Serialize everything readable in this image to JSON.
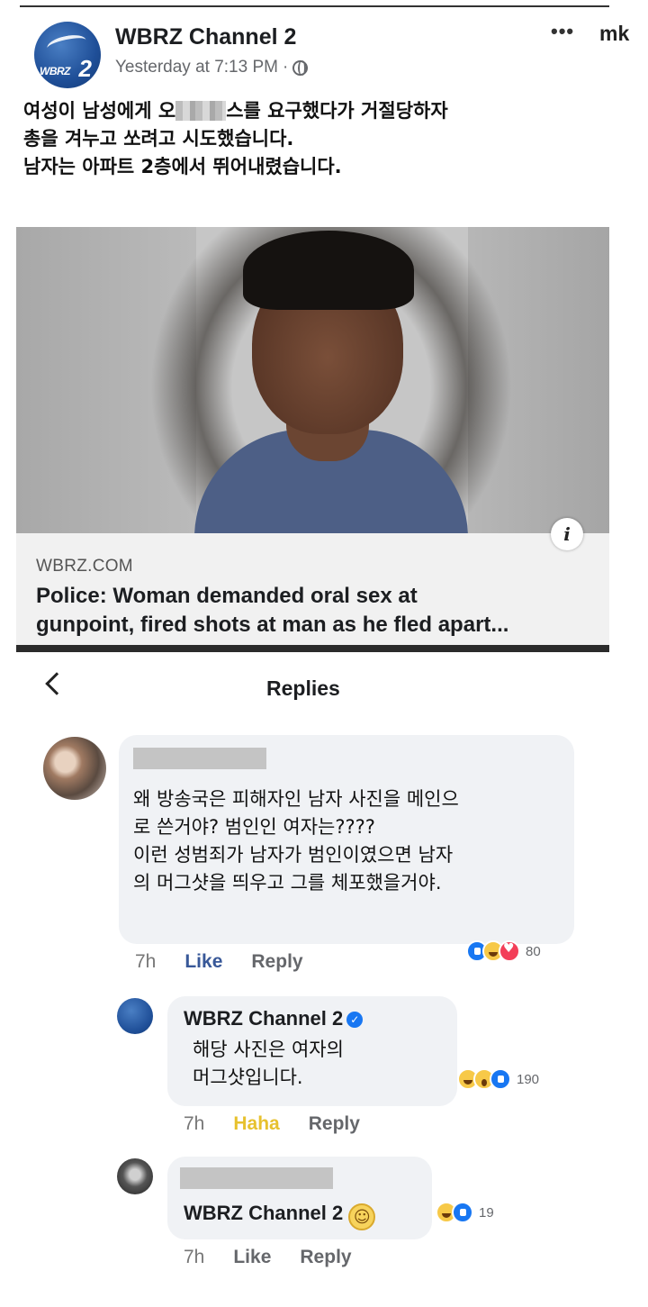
{
  "post": {
    "page_name": "WBRZ Channel 2",
    "timestamp": "Yesterday at 7:13 PM",
    "separator": "·",
    "more": "•••",
    "watermark": "mk",
    "avatar_logo_text": "WBRZ",
    "avatar_logo_num": "2",
    "text_line1_a": "여성이 남성에게 오",
    "text_line1_b": "스를 요구했다가 거절당하자",
    "text_line2": "총을 겨누고 쏘려고 시도했습니다.",
    "text_line3": "남자는 아파트 2층에서 뛰어내렸습니다."
  },
  "link": {
    "domain": "WBRZ.COM",
    "title_line1": "Police: Woman demanded oral sex at",
    "title_line2": "gunpoint, fired shots at man as he fled apart...",
    "info": "i"
  },
  "replies_header": {
    "title": "Replies"
  },
  "comments": [
    {
      "text_lines": [
        "왜 방송국은 피해자인 남자 사진을 메인으",
        "로 쓴거야? 범인인 여자는????",
        "이런 성범죄가 남자가 범인이였으면 남자",
        "의 머그샷을 띄우고 그를 체포했을거야."
      ],
      "time": "7h",
      "like": "Like",
      "reply": "Reply",
      "reaction_count": "80"
    },
    {
      "name": "WBRZ Channel 2",
      "verified": "✓",
      "text_lines": [
        "해당 사진은 여자의",
        "머그샷입니다."
      ],
      "time": "7h",
      "like": "Haha",
      "reply": "Reply",
      "reaction_count": "190"
    },
    {
      "text": "WBRZ Channel 2",
      "emoji": "☺",
      "time": "7h",
      "like": "Like",
      "reply": "Reply",
      "reaction_count": "19"
    }
  ],
  "colors": {
    "facebook_blue": "#1877f2",
    "like_active": "#385898",
    "haha_active": "#e7c12e",
    "bubble_bg": "#f0f2f5"
  }
}
